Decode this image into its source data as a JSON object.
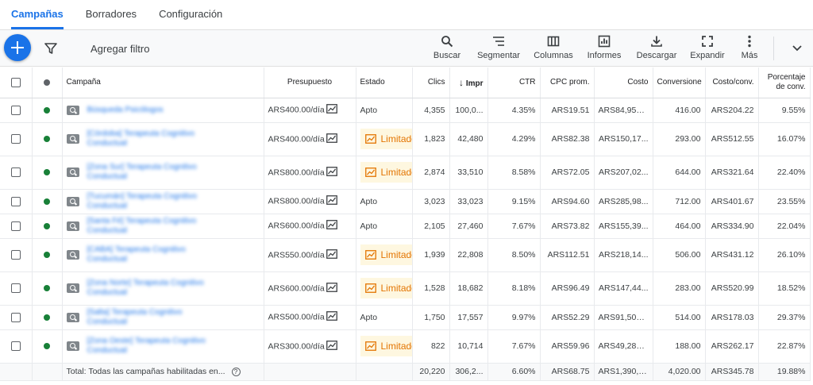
{
  "tabs": [
    "Campañas",
    "Borradores",
    "Configuración"
  ],
  "toolbar": {
    "add_filter": "Agregar filtro",
    "tools": [
      {
        "label": "Buscar",
        "icon": "search-icon"
      },
      {
        "label": "Segmentar",
        "icon": "segment-icon"
      },
      {
        "label": "Columnas",
        "icon": "columns-icon"
      },
      {
        "label": "Informes",
        "icon": "reports-icon"
      },
      {
        "label": "Descargar",
        "icon": "download-icon"
      },
      {
        "label": "Expandir",
        "icon": "expand-icon"
      },
      {
        "label": "Más",
        "icon": "more-vert-icon"
      }
    ]
  },
  "colors": {
    "accent": "#1a73e8",
    "enabled": "#188038",
    "header_dot": "#5f6368",
    "limited_bg": "#fef7e0",
    "limited_text": "#e37400"
  },
  "columns": {
    "campaign": "Campaña",
    "budget": "Presupuesto",
    "status": "Estado",
    "clicks": "Clics",
    "impr": "Impr",
    "ctr": "CTR",
    "cpc": "CPC prom.",
    "cost": "Costo",
    "conversions": "Conversione",
    "cost_conv": "Costo/conv.",
    "conv_rate": "Porcentaje de conv."
  },
  "rows": [
    {
      "campaign": "Búsqueda Psicólogos",
      "budget": "ARS400.00/día",
      "status": "Apto",
      "limited": false,
      "clicks": "4,355",
      "impr": "100,0...",
      "ctr": "4.35%",
      "cpc": "ARS19.51",
      "cost": "ARS84,955....",
      "conversions": "416.00",
      "cost_conv": "ARS204.22",
      "conv_rate": "9.55%"
    },
    {
      "campaign": "[Córdoba] Terapeuta Cognitivo Conductual",
      "budget": "ARS400.00/día",
      "status": "Limitado por presupuesto",
      "limited": true,
      "clicks": "1,823",
      "impr": "42,480",
      "ctr": "4.29%",
      "cpc": "ARS82.38",
      "cost": "ARS150,17...",
      "conversions": "293.00",
      "cost_conv": "ARS512.55",
      "conv_rate": "16.07%"
    },
    {
      "campaign": "[Zona Sur] Terapeuta Cognitivo Conductual",
      "budget": "ARS800.00/día",
      "status": "Limitado por presupuesto",
      "limited": true,
      "clicks": "2,874",
      "impr": "33,510",
      "ctr": "8.58%",
      "cpc": "ARS72.05",
      "cost": "ARS207,02...",
      "conversions": "644.00",
      "cost_conv": "ARS321.64",
      "conv_rate": "22.40%"
    },
    {
      "campaign": "[Tucumán] Terapeuta Cognitivo Conductual",
      "budget": "ARS800.00/día",
      "status": "Apto",
      "limited": false,
      "clicks": "3,023",
      "impr": "33,023",
      "ctr": "9.15%",
      "cpc": "ARS94.60",
      "cost": "ARS285,98...",
      "conversions": "712.00",
      "cost_conv": "ARS401.67",
      "conv_rate": "23.55%"
    },
    {
      "campaign": "[Santa Fé] Terapeuta Cognitivo Conductual",
      "budget": "ARS600.00/día",
      "status": "Apto",
      "limited": false,
      "clicks": "2,105",
      "impr": "27,460",
      "ctr": "7.67%",
      "cpc": "ARS73.82",
      "cost": "ARS155,39...",
      "conversions": "464.00",
      "cost_conv": "ARS334.90",
      "conv_rate": "22.04%"
    },
    {
      "campaign": "[CABA] Terapeuta Cognitivo Conductual",
      "budget": "ARS550.00/día",
      "status": "Limitado por presupuesto",
      "limited": true,
      "clicks": "1,939",
      "impr": "22,808",
      "ctr": "8.50%",
      "cpc": "ARS112.51",
      "cost": "ARS218,14...",
      "conversions": "506.00",
      "cost_conv": "ARS431.12",
      "conv_rate": "26.10%"
    },
    {
      "campaign": "[Zona Norte] Terapeuta Cognitivo Conductual",
      "budget": "ARS600.00/día",
      "status": "Limitado por presupuesto",
      "limited": true,
      "clicks": "1,528",
      "impr": "18,682",
      "ctr": "8.18%",
      "cpc": "ARS96.49",
      "cost": "ARS147,44...",
      "conversions": "283.00",
      "cost_conv": "ARS520.99",
      "conv_rate": "18.52%"
    },
    {
      "campaign": "[Salta] Terapeuta Cognitivo Conductual",
      "budget": "ARS500.00/día",
      "status": "Apto",
      "limited": false,
      "clicks": "1,750",
      "impr": "17,557",
      "ctr": "9.97%",
      "cpc": "ARS52.29",
      "cost": "ARS91,509....",
      "conversions": "514.00",
      "cost_conv": "ARS178.03",
      "conv_rate": "29.37%"
    },
    {
      "campaign": "[Zona Oeste] Terapeuta Cognitivo Conductual",
      "budget": "ARS300.00/día",
      "status": "Limitado por presupuesto",
      "limited": true,
      "clicks": "822",
      "impr": "10,714",
      "ctr": "7.67%",
      "cpc": "ARS59.96",
      "cost": "ARS49,288....",
      "conversions": "188.00",
      "cost_conv": "ARS262.17",
      "conv_rate": "22.87%"
    }
  ],
  "limited_label": "Limitado",
  "total": {
    "label": "Total: Todas las campañas habilitadas en...",
    "clicks": "20,220",
    "impr": "306,2...",
    "ctr": "6.60%",
    "cpc": "ARS68.75",
    "cost": "ARS1,390,0...",
    "conversions": "4,020.00",
    "cost_conv": "ARS345.78",
    "conv_rate": "19.88%"
  }
}
